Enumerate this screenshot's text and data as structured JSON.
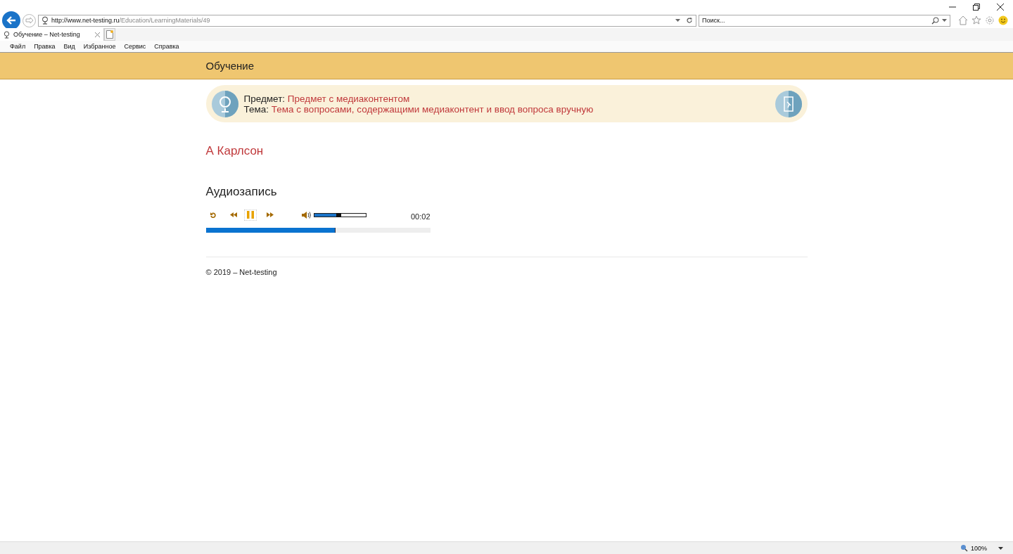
{
  "browser": {
    "address": {
      "host": "http://www.net-testing.ru",
      "path": "/Education/LearningMaterials/49"
    },
    "search": {
      "placeholder": "Поиск..."
    },
    "tabs": [
      {
        "label": "Обучение – Net-testing",
        "selected": true
      }
    ],
    "menu": [
      "Файл",
      "Правка",
      "Вид",
      "Избранное",
      "Сервис",
      "Справка"
    ],
    "zoom": "100%"
  },
  "header": {
    "title": "Обучение"
  },
  "info": {
    "subject_label": "Предмет:",
    "subject": "Предмет с медиаконтентом",
    "topic_label": "Тема:",
    "topic": "Тема с вопросами, содержащими медиаконтент и ввод вопроса вручную"
  },
  "author": "А Карлсон",
  "material": {
    "title": "Аудиозапись",
    "player": {
      "playing": true,
      "volume": {
        "level": 0.47
      },
      "time": "00:02",
      "progress": {
        "level": 0.575
      }
    }
  },
  "footer": "© 2019 – Net-testing"
}
